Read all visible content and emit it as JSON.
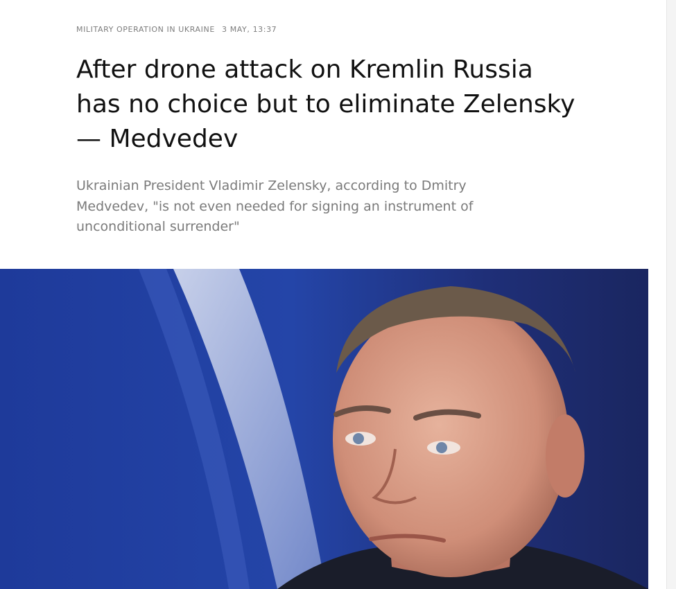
{
  "article": {
    "rubric": "Military operation in Ukraine",
    "date": "3 May, 13:37",
    "headline": "After drone attack on Kremlin Russia has no choice but to eliminate Zelensky — Medvedev",
    "lead": "Ukrainian President Vladimir Zelensky, according to Dmitry Medvedev, \"is not even needed for signing an instrument of unconditional surrender\""
  },
  "photo": {
    "subject": "portrait-photo",
    "colors": {
      "flag_blue": "#1f3b96",
      "flag_white": "#c9d4ec",
      "background_navy": "#1d2a63",
      "skin": "#d9a08a",
      "hair": "#6b5a4a",
      "suit": "#1a1d2a"
    }
  }
}
